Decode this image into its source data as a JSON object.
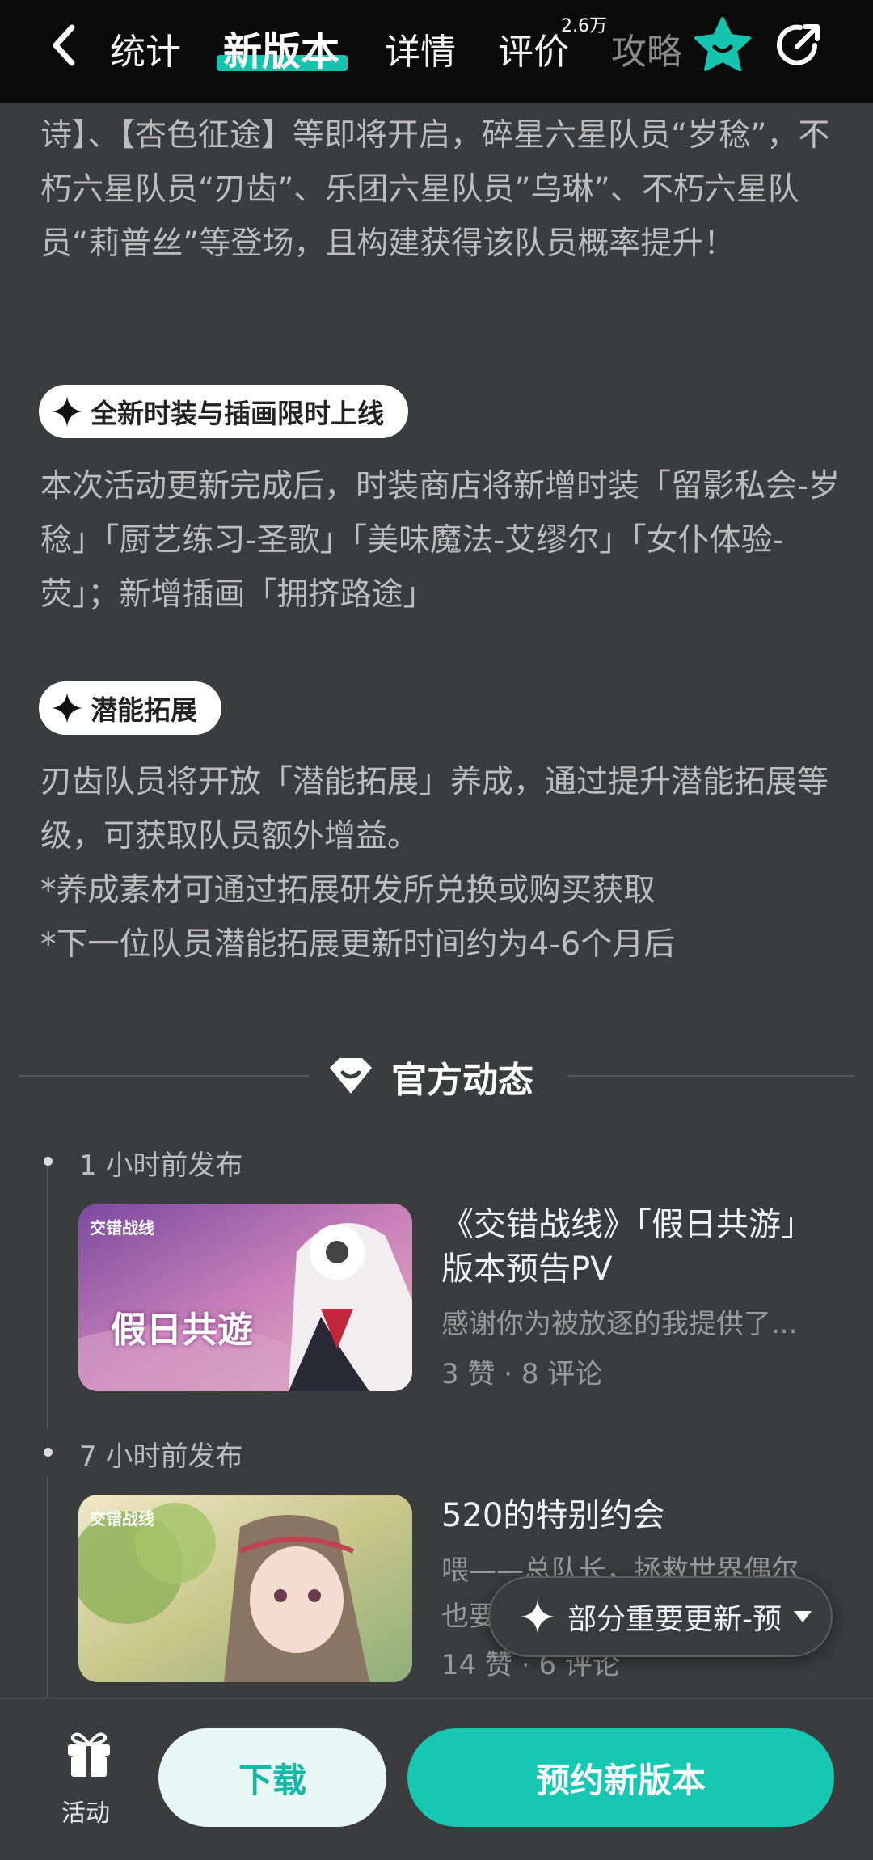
{
  "header": {
    "tabs": [
      {
        "label": "统计"
      },
      {
        "label": "新版本"
      },
      {
        "label": "详情"
      },
      {
        "label": "评价"
      },
      {
        "label": "攻略"
      }
    ],
    "review_count_badge": "2.6万",
    "active_tab": "新版本",
    "accent_color": "#16c3ae",
    "icons": {
      "back": "chevron-left-icon",
      "favorite": "star-face-icon",
      "share": "share-icon"
    }
  },
  "update_notes": {
    "intro_text": "诗】、【杏色征途】等即将开启，碎星六星队员“岁稔”，不朽六星队员“刃齿”、乐团六星队员”乌琳”、不朽六星队员“莉普丝”等登场，且构建获得该队员概率提升！",
    "sections": [
      {
        "tag": "全新时装与插画限时上线",
        "body": "本次活动更新完成后，时装商店将新增时装「留影私会-岁稔」「厨艺练习-圣歌」「美味魔法-艾缪尔」「女仆体验-荧」；新增插画「拥挤路途」"
      },
      {
        "tag": "潜能拓展",
        "body": "刃齿队员将开放「潜能拓展」养成，通过提升潜能拓展等级，可获取队员额外增益。",
        "notes": [
          "*养成素材可通过拓展研发所兑换或购买获取",
          "*下一位队员潜能拓展更新时间约为4-6个月后"
        ]
      }
    ]
  },
  "official_news": {
    "title": "官方动态",
    "posts": [
      {
        "time": "1 小时前发布",
        "title": "《交错战线》「假日共游」版本预告PV",
        "snippet": "感谢你为被放逐的我提供了...",
        "meta": "3 赞 · 8 评论",
        "thumb_logo": "交错战线",
        "thumb_caption": "假日共遊"
      },
      {
        "time": "7 小时前发布",
        "title": "520的特别约会",
        "snippet": "喂——总队长，拯救世界偶尔",
        "snippet_line2": "也要",
        "meta": "14 赞 · 6 评论",
        "thumb_logo": "交错战线"
      }
    ]
  },
  "floating_button": {
    "label": "部分重要更新-预"
  },
  "bottom_bar": {
    "activity_label": "活动",
    "download_label": "下载",
    "reserve_label": "预约新版本"
  }
}
